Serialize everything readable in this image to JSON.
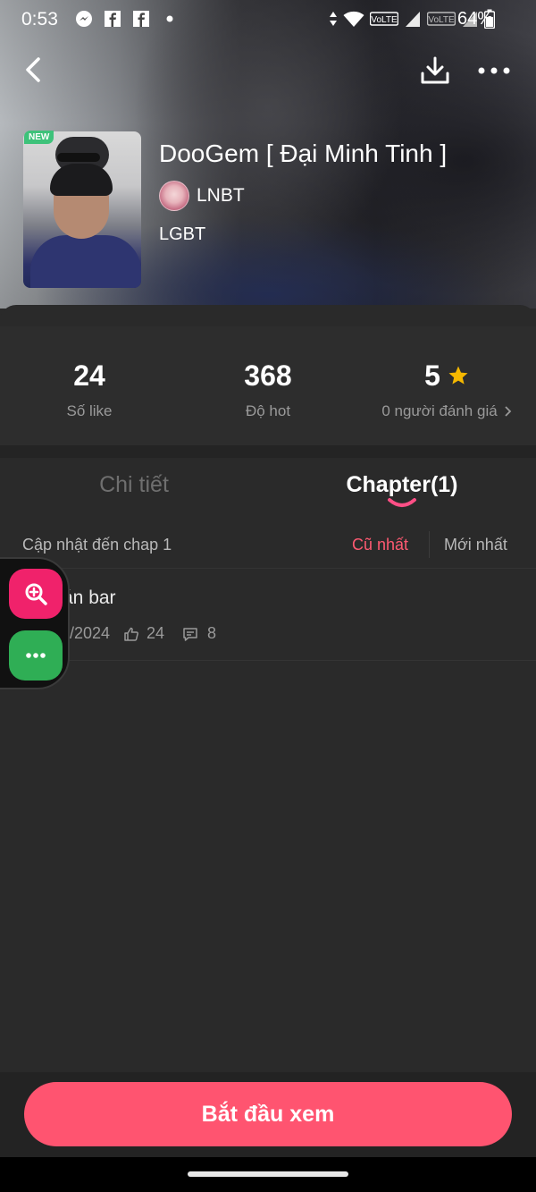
{
  "status_bar": {
    "time": "0:53",
    "battery": "64%",
    "icons": [
      "messenger-icon",
      "facebook-icon",
      "facebook-icon",
      "dot-icon",
      "data-arrows-icon",
      "wifi-icon",
      "volte-icon",
      "signal-icon",
      "volte-icon",
      "signal-icon",
      "battery-icon"
    ]
  },
  "header": {
    "actions": [
      "back-icon",
      "download-icon",
      "more-icon"
    ]
  },
  "comic": {
    "badge": "NEW",
    "title": "DooGem [ Đại Minh Tinh ]",
    "author": "LNBT",
    "genre": "LGBT"
  },
  "stats": {
    "likes": {
      "value": "24",
      "label": "Số like"
    },
    "hot": {
      "value": "368",
      "label": "Độ hot"
    },
    "rating": {
      "value": "5",
      "label": "0 người đánh giá"
    }
  },
  "tabs": {
    "detail": "Chi tiết",
    "chapter": "Chapter(1)",
    "active": "chapter"
  },
  "list_header": {
    "update_text": "Cập nhật đến chap 1",
    "sort_oldest": "Cũ nhất",
    "sort_newest": "Mới nhất",
    "active_sort": "oldest"
  },
  "chapters": [
    {
      "title": "án bar",
      "date": "/2024",
      "likes": "24",
      "comments": "8"
    }
  ],
  "bottom": {
    "start_label": "Bắt đầu xem"
  },
  "colors": {
    "accent": "#ff5470",
    "star": "#f5b800",
    "float_zoom": "#f0226b",
    "float_more": "#2fae55"
  }
}
